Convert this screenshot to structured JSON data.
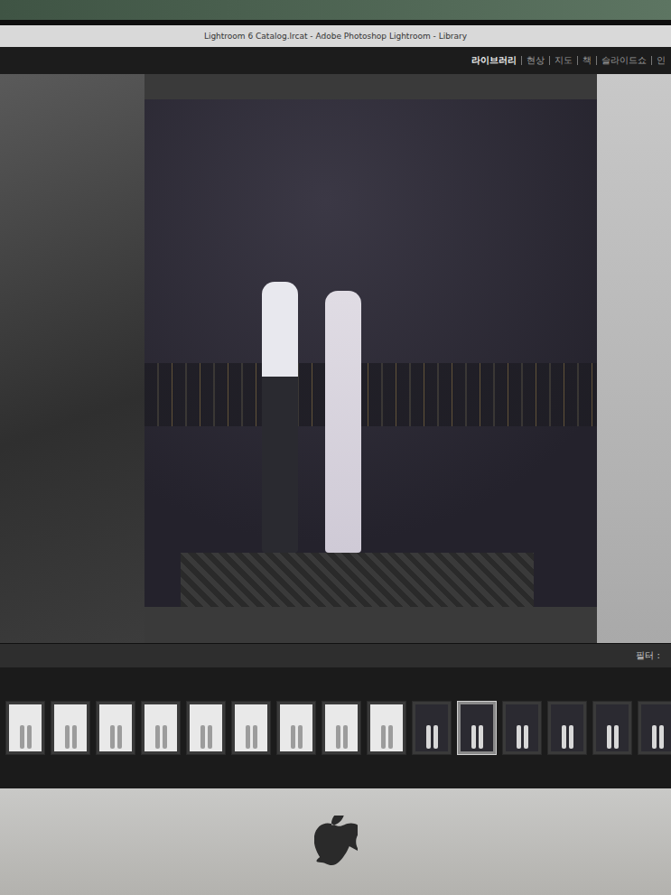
{
  "window": {
    "title": "Lightroom 6 Catalog.lrcat - Adobe Photoshop Lightroom - Library"
  },
  "modules": [
    {
      "label": "라이브러리",
      "selected": true
    },
    {
      "label": "현상",
      "selected": false
    },
    {
      "label": "지도",
      "selected": false
    },
    {
      "label": "책",
      "selected": false
    },
    {
      "label": "슬라이드쇼",
      "selected": false
    },
    {
      "label": "인",
      "selected": false
    }
  ],
  "filmstrip": {
    "filter_label": "필터 :",
    "thumbnails": [
      {
        "kind": "light",
        "selected": false
      },
      {
        "kind": "light",
        "selected": false
      },
      {
        "kind": "light",
        "selected": false
      },
      {
        "kind": "light",
        "selected": false
      },
      {
        "kind": "light",
        "selected": false
      },
      {
        "kind": "light",
        "selected": false
      },
      {
        "kind": "light",
        "selected": false
      },
      {
        "kind": "light",
        "selected": false
      },
      {
        "kind": "light",
        "selected": false
      },
      {
        "kind": "dark",
        "selected": false
      },
      {
        "kind": "dark",
        "selected": true
      },
      {
        "kind": "dark",
        "selected": false
      },
      {
        "kind": "dark",
        "selected": false
      },
      {
        "kind": "dark",
        "selected": false
      },
      {
        "kind": "dark",
        "selected": false
      },
      {
        "kind": "dark",
        "selected": false
      },
      {
        "kind": "light",
        "selected": false
      }
    ]
  }
}
